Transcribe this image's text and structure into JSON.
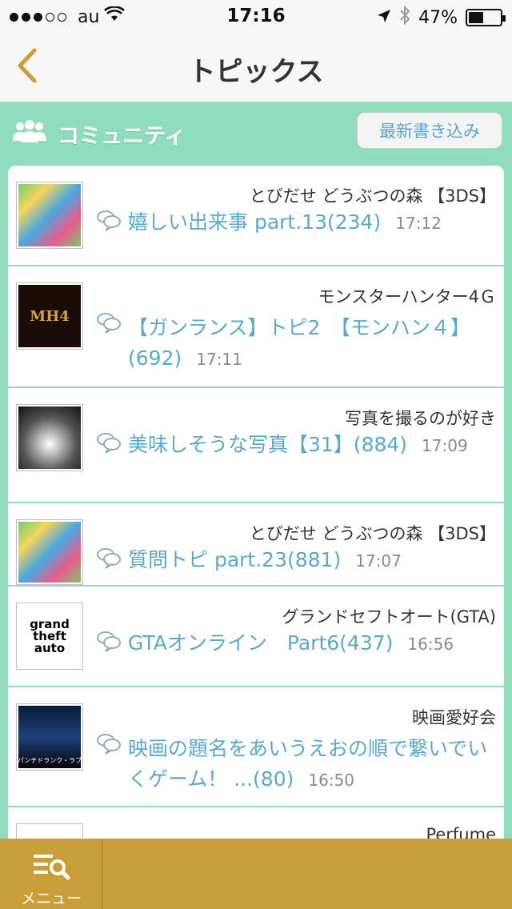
{
  "status": {
    "carrier": "au",
    "time": "17:16",
    "battery": "47%",
    "battery_fraction": 0.47
  },
  "nav": {
    "title": "トピックス"
  },
  "community": {
    "label": "コミュニティ",
    "latest_button": "最新書き込み"
  },
  "topics": [
    {
      "community": "とびだせ どうぶつの森 【3DS】",
      "title": "嬉しい出来事 part.13(234)",
      "time": "17:12",
      "thumb": "acnl"
    },
    {
      "community": "モンスターハンター4Ｇ",
      "title": "【ガンランス】トピ2　【モンハン４】(692)",
      "time": "17:11",
      "thumb": "mh4",
      "thumb_text": "MH4"
    },
    {
      "community": "写真を撮るのが好き",
      "title": "美味しそうな写真【31】(884)",
      "time": "17:09",
      "thumb": "photo"
    },
    {
      "community": "とびだせ どうぶつの森 【3DS】",
      "title": "質問トピ part.23(881)",
      "time": "17:07",
      "thumb": "acnl"
    },
    {
      "community": "グランドセフトオート(GTA)",
      "title": "GTAオンライン　Part6(437)",
      "time": "16:56",
      "thumb": "gta",
      "thumb_text": "grand theft auto"
    },
    {
      "community": "映画愛好会",
      "title": "映画の題名をあいうえおの順で繋いでいくゲーム！ ...(80)",
      "time": "16:50",
      "thumb": "movie",
      "thumb_text": "パンチドランク・ラブ"
    },
    {
      "community": "Perfume",
      "title": "",
      "time": "",
      "thumb": "blank"
    }
  ],
  "tabbar": {
    "menu_label": "メニュー"
  },
  "colors": {
    "mint": "#8fdcbf",
    "gold": "#c99d3a",
    "link": "#5aa9cc"
  }
}
